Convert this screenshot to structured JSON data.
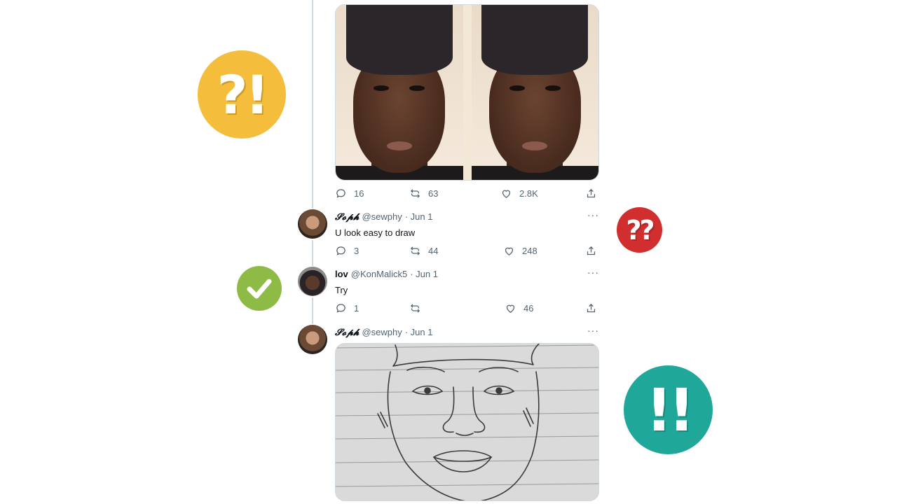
{
  "main_tweet": {
    "image_alt": "Two side-by-side passport-style photos of a young man wearing a black durag",
    "stats": {
      "replies": "16",
      "retweets": "63",
      "likes": "2.8K"
    }
  },
  "replies": [
    {
      "name": "𝓢𝓸𝓹𝓱",
      "handle": "@sewphy",
      "date": "· Jun 1",
      "text": "U look easy to draw",
      "stats": {
        "replies": "3",
        "retweets": "44",
        "likes": "248"
      }
    },
    {
      "name": "lov",
      "handle": "@KonMalick5",
      "date": "· Jun 1",
      "text": "Try",
      "stats": {
        "replies": "1",
        "retweets": "",
        "likes": "46"
      }
    },
    {
      "name": "𝓢𝓸𝓹𝓱",
      "handle": "@sewphy",
      "date": "· Jun 1",
      "image_alt": "Pencil sketch of a face with a durag on lined paper"
    }
  ],
  "more_label": "···",
  "badges": {
    "yellow": "?!",
    "red": "??",
    "teal": "!!",
    "green_icon": "check-icon"
  },
  "colors": {
    "yellow": "#f5bd3c",
    "red": "#d12f2f",
    "green": "#8dbb45",
    "teal": "#1fa79a",
    "muted_text": "#536471"
  }
}
